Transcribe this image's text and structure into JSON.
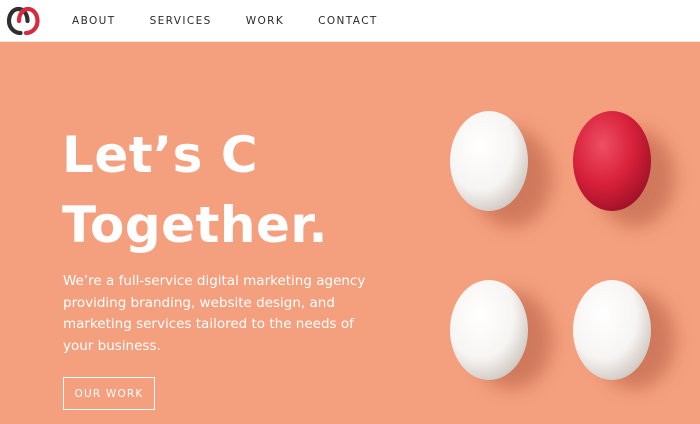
{
  "brand": {
    "logo_icon": "interlocking-rings-logo",
    "colors": {
      "ring_dark": "#2f2f33",
      "ring_red": "#d62a3e"
    }
  },
  "nav": {
    "links": [
      "ABOUT",
      "SERVICES",
      "WORK",
      "CONTACT"
    ]
  },
  "hero": {
    "background_color": "#f4a07e",
    "headline_line1": "Let’s C",
    "headline_line2": "Together.",
    "body": "We’re a full-service digital marketing agency providing branding, website design, and marketing services tailored to the needs of your business.",
    "cta_label": "OUR WORK",
    "image": {
      "description_icon": "eggs-image",
      "egg_colors": [
        "#ffffff",
        "#d8203a",
        "#ffffff",
        "#ffffff"
      ]
    }
  }
}
